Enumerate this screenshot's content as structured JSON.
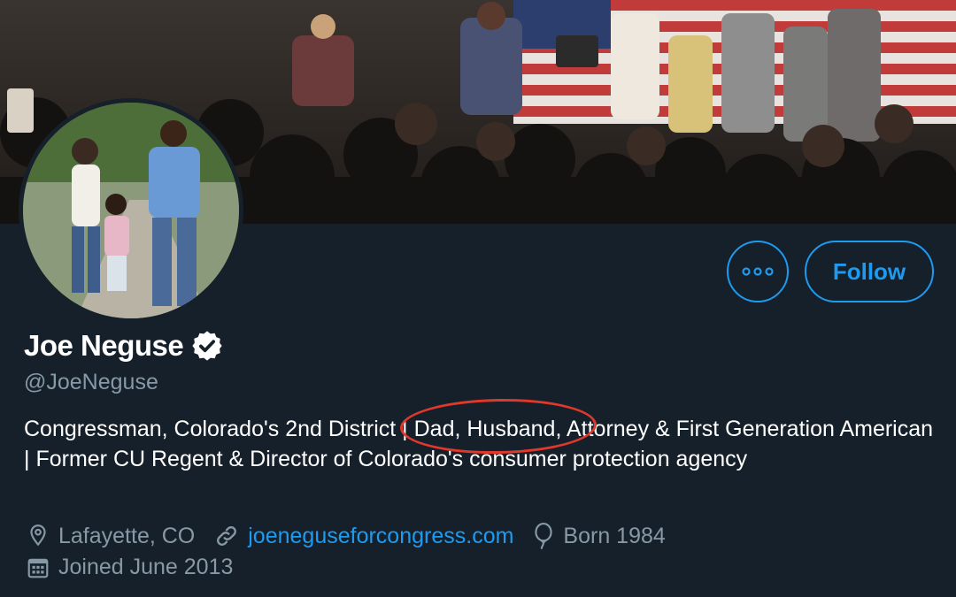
{
  "profile": {
    "name": "Joe Neguse",
    "handle": "@JoeNeguse",
    "bio_before": "Congressman, Colorado's 2nd District | ",
    "bio_highlight": "Dad, Husband,",
    "bio_after": " Attorney & First Generation American | Former CU Regent & Director of Colorado's consumer protection agency",
    "location": "Lafayette, CO",
    "website": "joeneguseforcongress.com",
    "birth": "Born 1984",
    "joined": "Joined June 2013"
  },
  "actions": {
    "follow_label": "Follow"
  },
  "icons": {
    "verified": "verified-badge-icon",
    "more": "more-options-icon",
    "location": "location-pin-icon",
    "link": "link-icon",
    "birthday": "balloon-icon",
    "calendar": "calendar-icon"
  },
  "colors": {
    "background": "#15202b",
    "accent": "#1d9bf0",
    "secondary_text": "#8899a6",
    "annotation": "#e0382b"
  }
}
